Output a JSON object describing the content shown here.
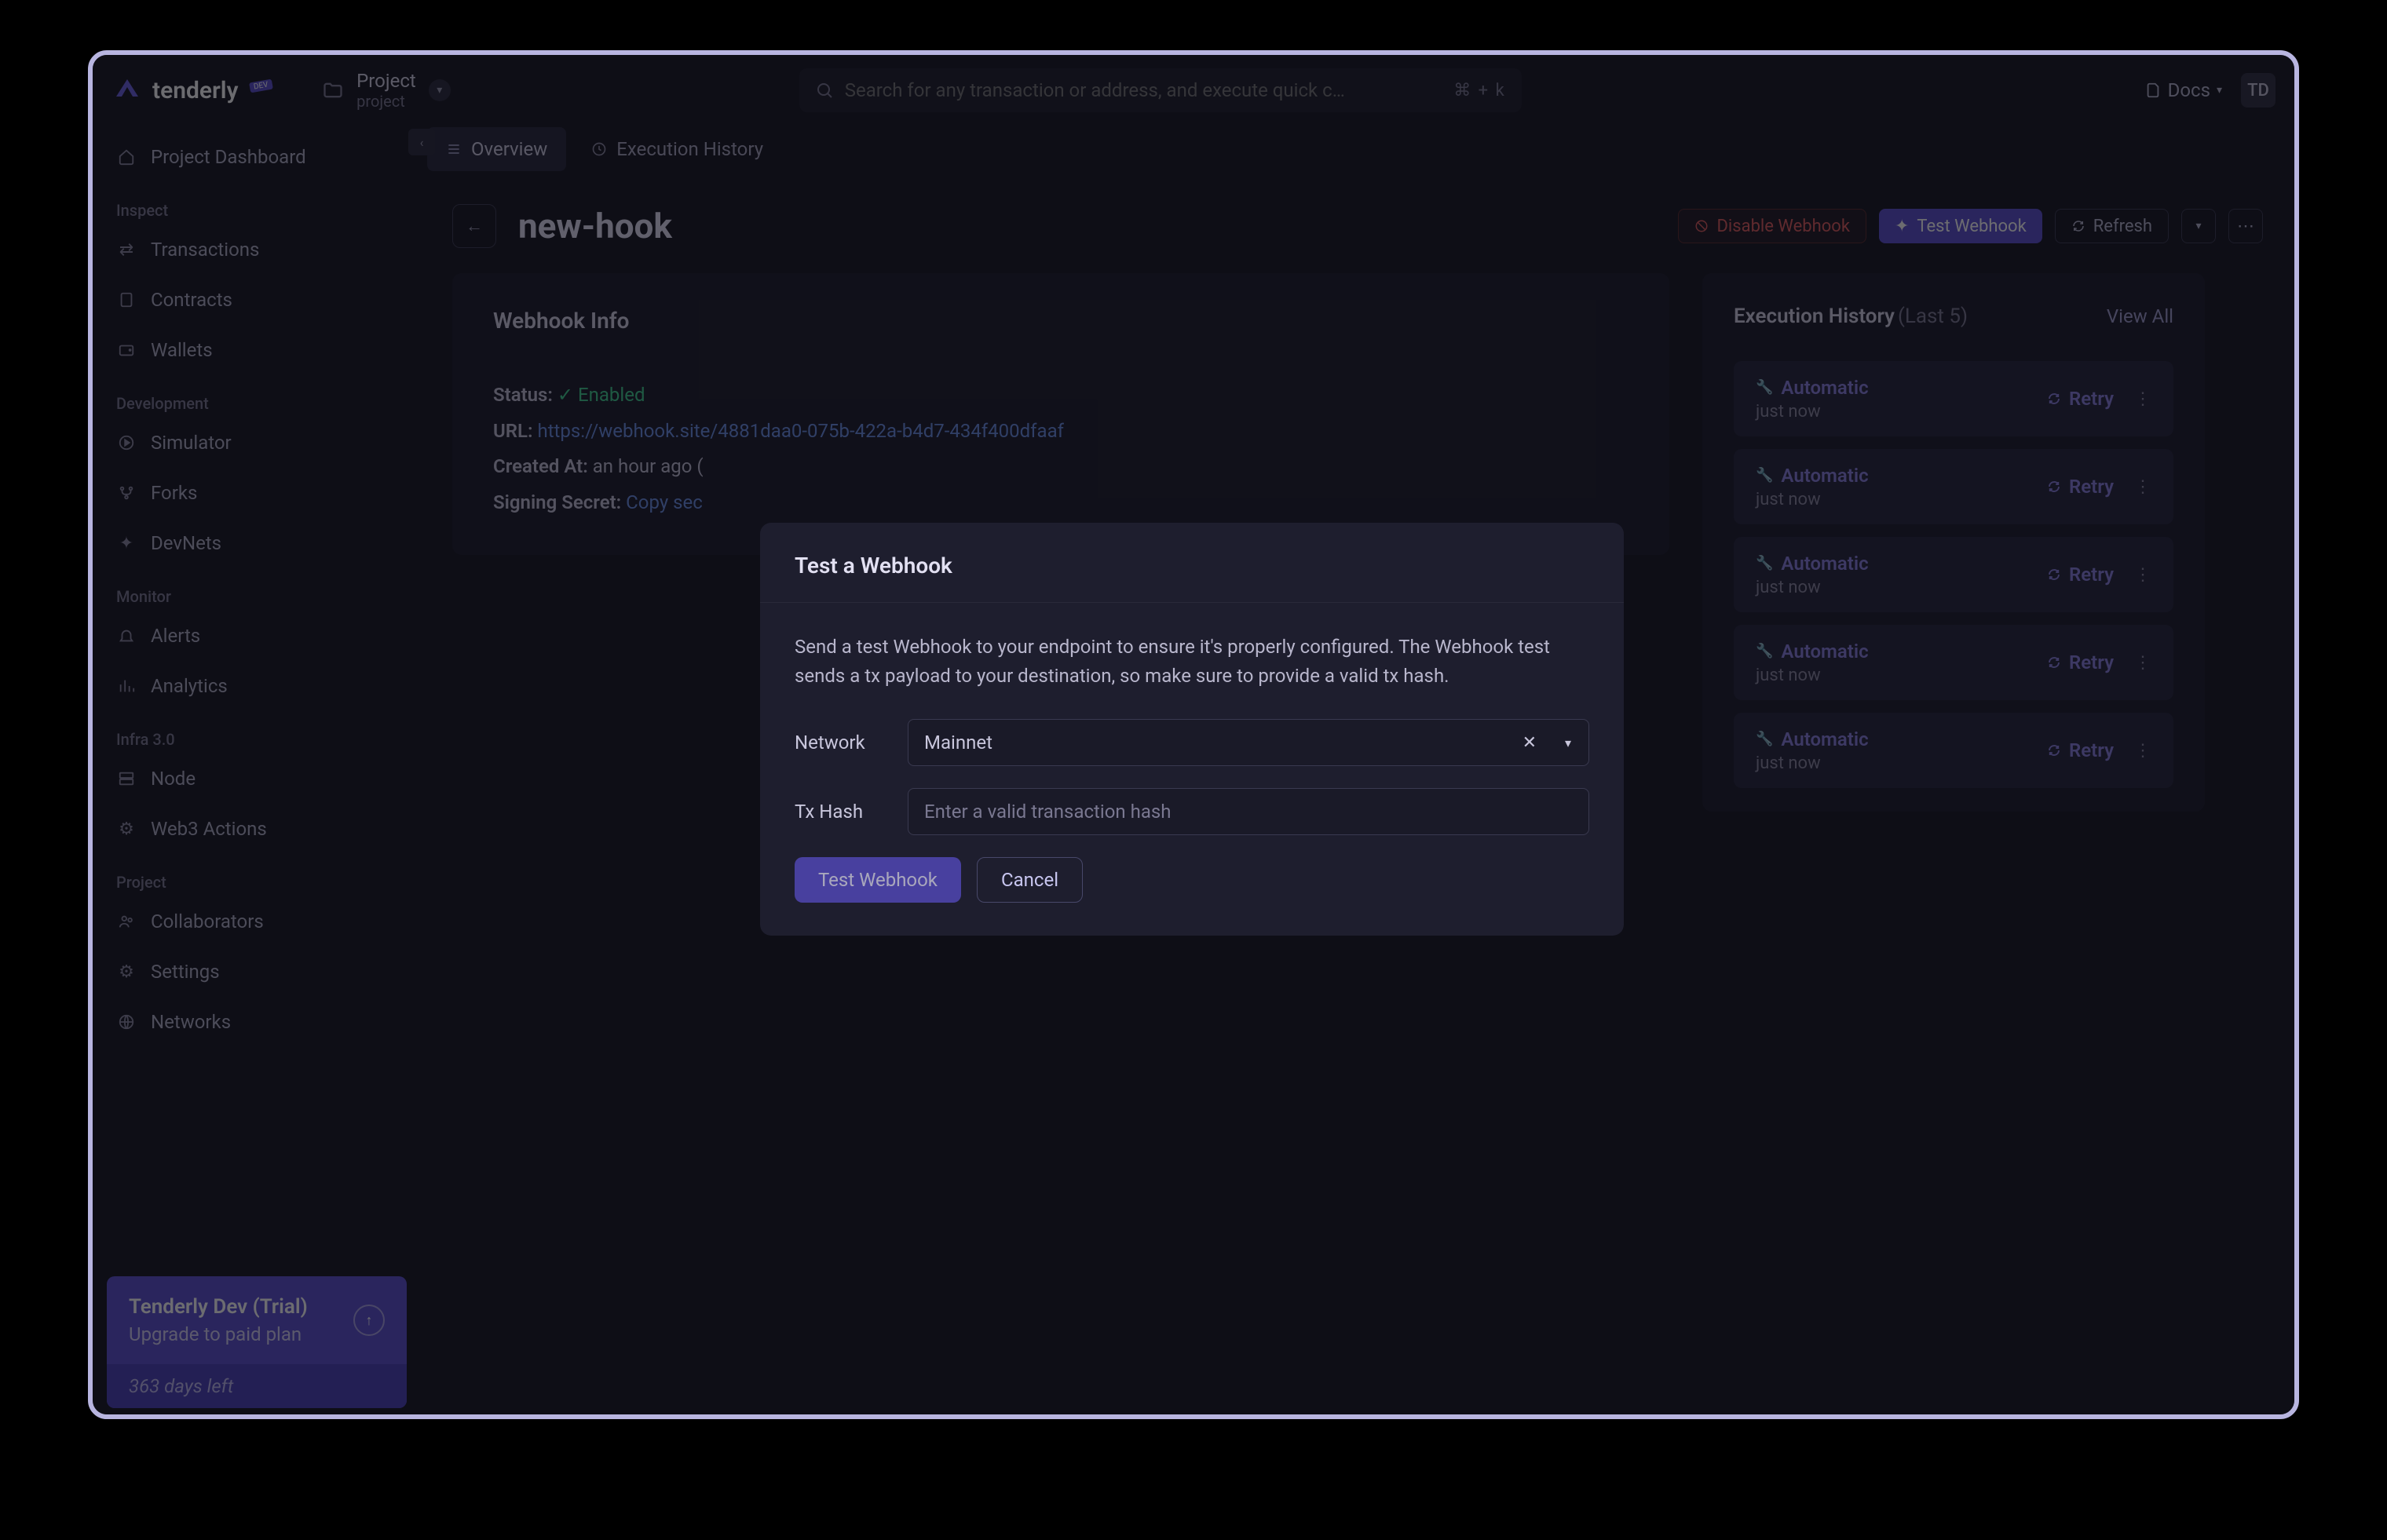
{
  "brand": {
    "name": "tenderly",
    "badge": "DEV"
  },
  "project": {
    "label": "Project",
    "slug": "project"
  },
  "search": {
    "placeholder": "Search for any transaction or address, and execute quick c…",
    "shortcut": "⌘ + k"
  },
  "topbar": {
    "docs": "Docs",
    "avatar": "TD"
  },
  "sidebar": {
    "items": [
      {
        "label": "Project Dashboard"
      }
    ],
    "inspect_label": "Inspect",
    "inspect": [
      {
        "label": "Transactions"
      },
      {
        "label": "Contracts"
      },
      {
        "label": "Wallets"
      }
    ],
    "dev_label": "Development",
    "dev": [
      {
        "label": "Simulator"
      },
      {
        "label": "Forks"
      },
      {
        "label": "DevNets"
      }
    ],
    "monitor_label": "Monitor",
    "monitor": [
      {
        "label": "Alerts"
      },
      {
        "label": "Analytics"
      }
    ],
    "infra_label": "Infra 3.0",
    "infra": [
      {
        "label": "Node"
      },
      {
        "label": "Web3 Actions"
      }
    ],
    "project_label": "Project",
    "proj": [
      {
        "label": "Collaborators"
      },
      {
        "label": "Settings"
      },
      {
        "label": "Networks"
      }
    ]
  },
  "upgrade": {
    "title": "Tenderly Dev (Trial)",
    "subtitle": "Upgrade to paid plan",
    "days": "363 days left"
  },
  "tabs": {
    "overview": "Overview",
    "exec": "Execution History"
  },
  "page": {
    "title": "new-hook",
    "disable": "Disable Webhook",
    "test": "Test Webhook",
    "refresh": "Refresh"
  },
  "info": {
    "title": "Webhook Info",
    "status_label": "Status:",
    "status_value": "Enabled",
    "url_label": "URL:",
    "url_value": "https://webhook.site/4881daa0-075b-422a-b4d7-434f400dfaaf",
    "created_label": "Created At:",
    "created_value": "an hour ago (",
    "secret_label": "Signing Secret:",
    "secret_value": "Copy sec"
  },
  "history": {
    "title": "Execution History",
    "subtitle": "(Last 5)",
    "view_all": "View All",
    "items": [
      {
        "type": "Automatic",
        "time": "just now",
        "retry": "Retry"
      },
      {
        "type": "Automatic",
        "time": "just now",
        "retry": "Retry"
      },
      {
        "type": "Automatic",
        "time": "just now",
        "retry": "Retry"
      },
      {
        "type": "Automatic",
        "time": "just now",
        "retry": "Retry"
      },
      {
        "type": "Automatic",
        "time": "just now",
        "retry": "Retry"
      }
    ]
  },
  "modal": {
    "title": "Test a Webhook",
    "desc": "Send a test Webhook to your endpoint to ensure it's properly configured. The Webhook test sends a tx payload to your destination, so make sure to provide a valid tx hash.",
    "network_label": "Network",
    "network_value": "Mainnet",
    "txhash_label": "Tx Hash",
    "txhash_placeholder": "Enter a valid transaction hash",
    "test_btn": "Test Webhook",
    "cancel_btn": "Cancel"
  }
}
